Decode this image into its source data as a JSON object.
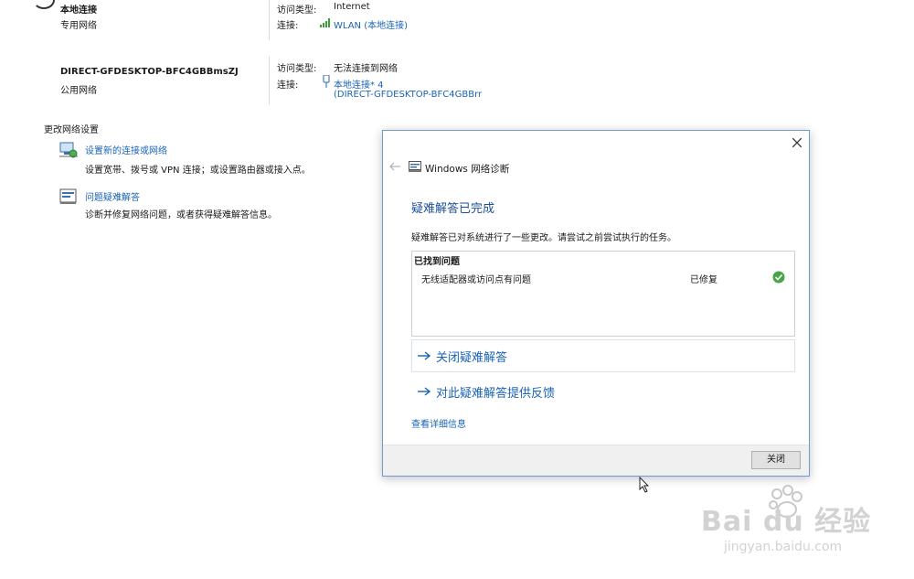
{
  "connections": [
    {
      "name": "本地连接",
      "network_type": "专用网络",
      "access_label": "访问类型:",
      "access_value": "Internet",
      "conn_label": "连接:",
      "conn_value": "WLAN (本地连接)"
    },
    {
      "name": "DIRECT-GFDESKTOP-BFC4GBBmsZJ",
      "network_type": "公用网络",
      "access_label": "访问类型:",
      "access_value": "无法连接到网络",
      "conn_label": "连接:",
      "conn_value_line1": "本地连接* 4",
      "conn_value_line2": "(DIRECT-GFDESKTOP-BFC4GBBrr"
    }
  ],
  "change_settings": {
    "heading": "更改网络设置",
    "items": [
      {
        "title": "设置新的连接或网络",
        "desc": "设置宽带、拨号或 VPN 连接；或设置路由器或接入点。",
        "icon": "network-setup-icon"
      },
      {
        "title": "问题疑难解答",
        "desc": "诊断并修复网络问题，或者获得疑难解答信息。",
        "icon": "troubleshoot-icon"
      }
    ]
  },
  "dialog": {
    "window_title": "Windows 网络诊断",
    "heading": "疑难解答已完成",
    "description": "疑难解答已对系统进行了一些更改。请尝试之前尝试执行的任务。",
    "problems_header": "已找到问题",
    "problem_text": "无线适配器或访问点有问题",
    "problem_status": "已修复",
    "close_troubleshooter": "关闭疑难解答",
    "feedback": "对此疑难解答提供反馈",
    "details_link": "查看详细信息",
    "close_button": "关闭"
  },
  "watermark": {
    "text": "Bai du 经验",
    "url": "jingyan.baidu.com"
  }
}
